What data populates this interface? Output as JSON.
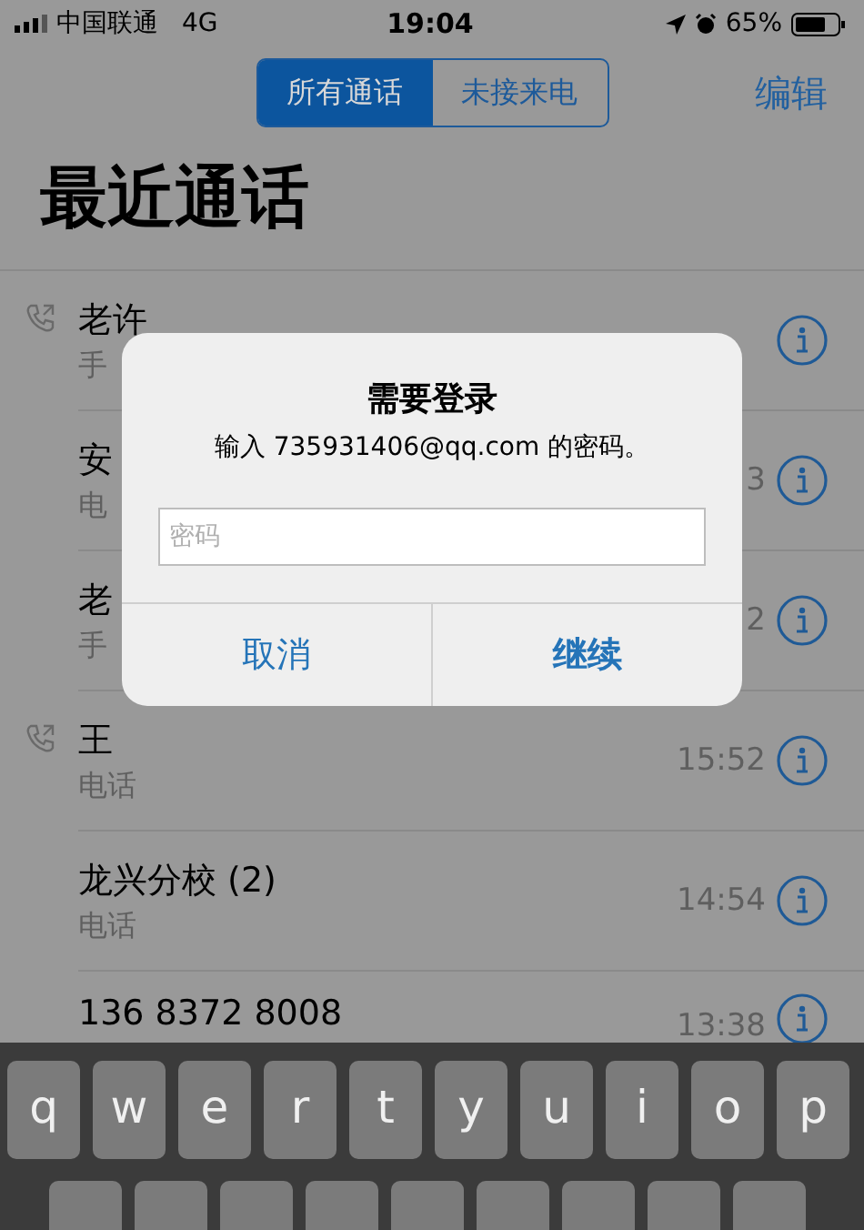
{
  "status_bar": {
    "carrier": "中国联通",
    "network": "4G",
    "time": "19:04",
    "battery": "65%"
  },
  "segments": [
    {
      "label": "所有通话",
      "selected": true
    },
    {
      "label": "未接来电",
      "selected": false
    }
  ],
  "edit_button": "编辑",
  "title": "最近通话",
  "calls": [
    {
      "name": "老许",
      "detail": "手",
      "outgoing": true
    },
    {
      "name": "安",
      "detail": "电",
      "time": "3",
      "outgoing": false
    },
    {
      "name": "老",
      "detail": "手",
      "time": "2",
      "outgoing": false
    },
    {
      "name": "王",
      "detail": "电话",
      "time": "15:52",
      "outgoing": true
    },
    {
      "name": "龙兴分校 (2)",
      "detail": "电话",
      "time": "14:54",
      "outgoing": false
    },
    {
      "name": "136 8372 8008",
      "time": "13:38",
      "outgoing": false
    }
  ],
  "dialog": {
    "title": "需要登录",
    "message": "输入 735931406@qq.com 的密码。",
    "placeholder": "密码",
    "buttons": [
      "取消",
      "继续"
    ]
  },
  "keyboard": {
    "rows": [
      [
        "q",
        "w",
        "e",
        "r",
        "t",
        "y",
        "u",
        "i",
        "o",
        "p"
      ]
    ]
  }
}
